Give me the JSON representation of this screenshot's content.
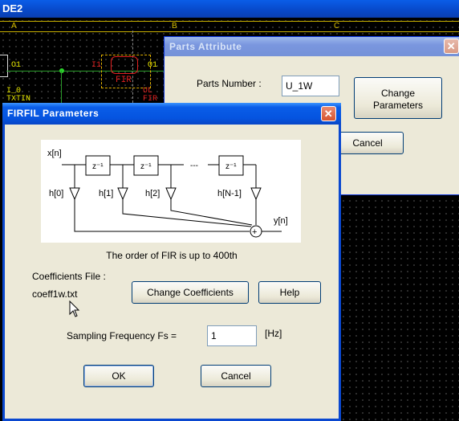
{
  "schematic": {
    "title": "DE2",
    "ruler": [
      "A",
      "B",
      "C"
    ],
    "labels": {
      "o1": "O1",
      "i0": "I_0",
      "txtin": "TXTIN",
      "i1": "I1",
      "o1b": "O1",
      "fir": "FIR",
      "ul": "UL",
      "fir2": "FIR"
    }
  },
  "parts_dialog": {
    "title": "Parts Attribute",
    "parts_number_label": "Parts Number :",
    "parts_number_value": "U_1W",
    "change_parameters": "Change Parameters",
    "cancel": "Cancel"
  },
  "firfil_dialog": {
    "title": "FIRFIL Parameters",
    "diagram": {
      "x": "x[n]",
      "y": "y[n]",
      "delay": "z⁻¹",
      "dots": "---",
      "coeffs": [
        "h[0]",
        "h[1]",
        "h[2]",
        "h[N-1]"
      ]
    },
    "order_text": "The order of FIR is up to 400th",
    "coeff_file_label": "Coefficients File :",
    "coeff_file_value": "coeff1w.txt",
    "change_coefficients": "Change Coefficients",
    "help": "Help",
    "fs_label": "Sampling Frequency Fs =",
    "fs_value": "1",
    "fs_unit": "[Hz]",
    "ok": "OK",
    "cancel": "Cancel"
  }
}
